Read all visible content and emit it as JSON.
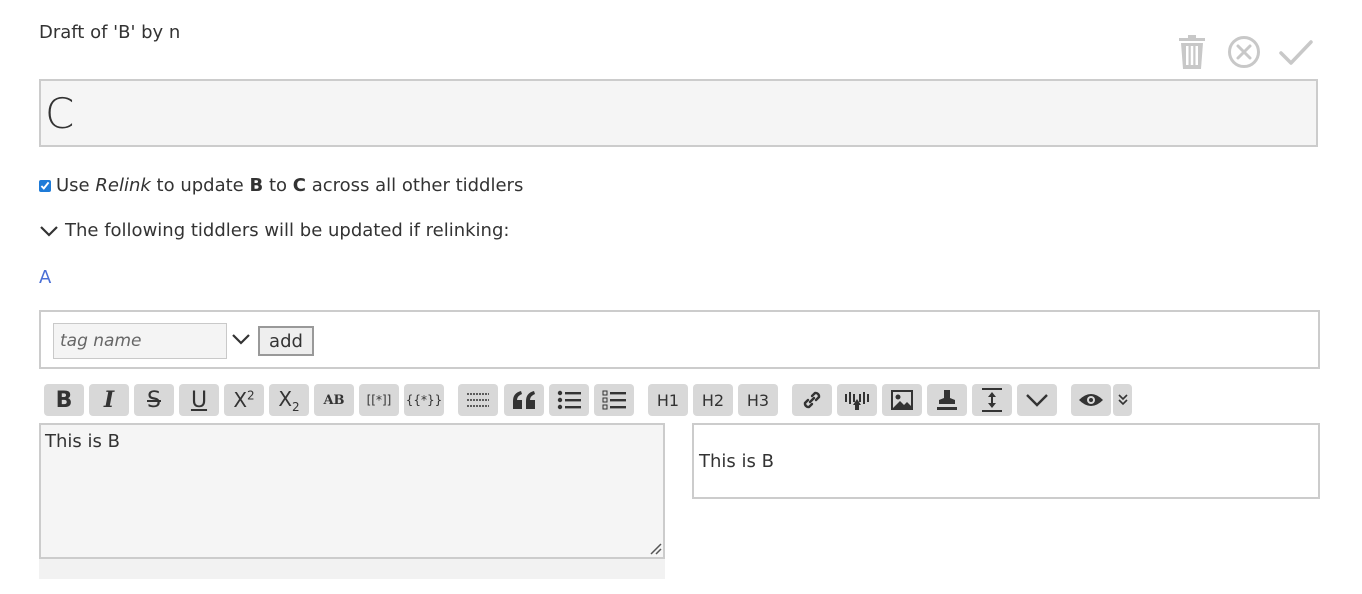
{
  "header": {
    "subtitle": "Draft of 'B' by n"
  },
  "toolbar_actions": [
    {
      "name": "delete",
      "icon": "trash-icon"
    },
    {
      "name": "cancel",
      "icon": "close-circle-icon"
    },
    {
      "name": "done",
      "icon": "check-icon"
    }
  ],
  "title": {
    "value": "C"
  },
  "relink": {
    "checked": true,
    "use": "Use",
    "relink_word": "Relink",
    "to_update": "to update",
    "from": "B",
    "to": "to",
    "target": "C",
    "across": "across all other tiddlers"
  },
  "following": {
    "label": "The following tiddlers will be updated if relinking:"
  },
  "tiddlers": [
    "A"
  ],
  "tags": {
    "placeholder": "tag name",
    "add_label": "add"
  },
  "editor_toolbar": {
    "bold": "B",
    "italic": "I",
    "strike": "S",
    "underline": "U",
    "superscript": "X",
    "superscript_mark": "2",
    "subscript": "X",
    "subscript_mark": "2",
    "smallcaps": "AB",
    "transclude_link": "[[*]]",
    "transclude_macro": "{{*}}",
    "h1": "H1",
    "h2": "H2",
    "h3": "H3"
  },
  "editor": {
    "text": "This is B"
  },
  "preview": {
    "text": "This is B"
  }
}
